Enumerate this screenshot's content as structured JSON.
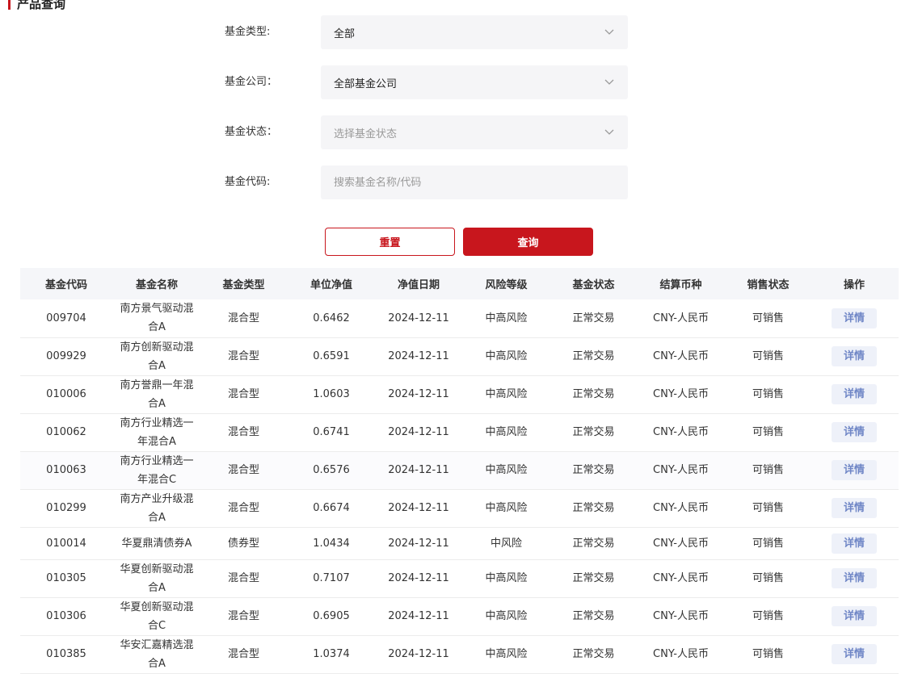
{
  "page_title": "产品查询",
  "filters": {
    "fund_type": {
      "label": "基金类型:",
      "value": "全部"
    },
    "fund_company": {
      "label": "基金公司：",
      "value": "全部基金公司"
    },
    "fund_status": {
      "label": "基金状态：",
      "placeholder": "选择基金状态"
    },
    "fund_code": {
      "label": "基金代码:",
      "placeholder": "搜索基金名称/代码"
    }
  },
  "buttons": {
    "reset": "重置",
    "search": "查询"
  },
  "table": {
    "headers": [
      "基金代码",
      "基金名称",
      "基金类型",
      "单位净值",
      "净值日期",
      "风险等级",
      "基金状态",
      "结算币种",
      "销售状态",
      "操作"
    ],
    "rows": [
      {
        "code": "009704",
        "name": "南方景气驱动混合A",
        "type": "混合型",
        "nav": "0.6462",
        "date": "2024-12-11",
        "risk": "中高风险",
        "status": "正常交易",
        "currency": "CNY-人民币",
        "sale": "可销售",
        "action": "详情"
      },
      {
        "code": "009929",
        "name": "南方创新驱动混合A",
        "type": "混合型",
        "nav": "0.6591",
        "date": "2024-12-11",
        "risk": "中高风险",
        "status": "正常交易",
        "currency": "CNY-人民币",
        "sale": "可销售",
        "action": "详情"
      },
      {
        "code": "010006",
        "name": "南方誉鼎一年混合A",
        "type": "混合型",
        "nav": "1.0603",
        "date": "2024-12-11",
        "risk": "中高风险",
        "status": "正常交易",
        "currency": "CNY-人民币",
        "sale": "可销售",
        "action": "详情"
      },
      {
        "code": "010062",
        "name": "南方行业精选一年混合A",
        "type": "混合型",
        "nav": "0.6741",
        "date": "2024-12-11",
        "risk": "中高风险",
        "status": "正常交易",
        "currency": "CNY-人民币",
        "sale": "可销售",
        "action": "详情"
      },
      {
        "code": "010063",
        "name": "南方行业精选一年混合C",
        "type": "混合型",
        "nav": "0.6576",
        "date": "2024-12-11",
        "risk": "中高风险",
        "status": "正常交易",
        "currency": "CNY-人民币",
        "sale": "可销售",
        "action": "详情"
      },
      {
        "code": "010299",
        "name": "南方产业升级混合A",
        "type": "混合型",
        "nav": "0.6674",
        "date": "2024-12-11",
        "risk": "中高风险",
        "status": "正常交易",
        "currency": "CNY-人民币",
        "sale": "可销售",
        "action": "详情"
      },
      {
        "code": "010014",
        "name": "华夏鼎清债券A",
        "type": "债券型",
        "nav": "1.0434",
        "date": "2024-12-11",
        "risk": "中风险",
        "status": "正常交易",
        "currency": "CNY-人民币",
        "sale": "可销售",
        "action": "详情"
      },
      {
        "code": "010305",
        "name": "华夏创新驱动混合A",
        "type": "混合型",
        "nav": "0.7107",
        "date": "2024-12-11",
        "risk": "中高风险",
        "status": "正常交易",
        "currency": "CNY-人民币",
        "sale": "可销售",
        "action": "详情"
      },
      {
        "code": "010306",
        "name": "华夏创新驱动混合C",
        "type": "混合型",
        "nav": "0.6905",
        "date": "2024-12-11",
        "risk": "中高风险",
        "status": "正常交易",
        "currency": "CNY-人民币",
        "sale": "可销售",
        "action": "详情"
      },
      {
        "code": "010385",
        "name": "华安汇嘉精选混合A",
        "type": "混合型",
        "nav": "1.0374",
        "date": "2024-12-11",
        "risk": "中高风险",
        "status": "正常交易",
        "currency": "CNY-人民币",
        "sale": "可销售",
        "action": "详情"
      }
    ]
  },
  "colors": {
    "accent": "#c8161d",
    "detail_text": "#6f86c6",
    "detail_bg": "#eef1f9",
    "header_bg": "#f5f6f9",
    "input_bg": "#f5f5f7"
  },
  "icons": {
    "select_arrow": "chevron-down-icon"
  }
}
